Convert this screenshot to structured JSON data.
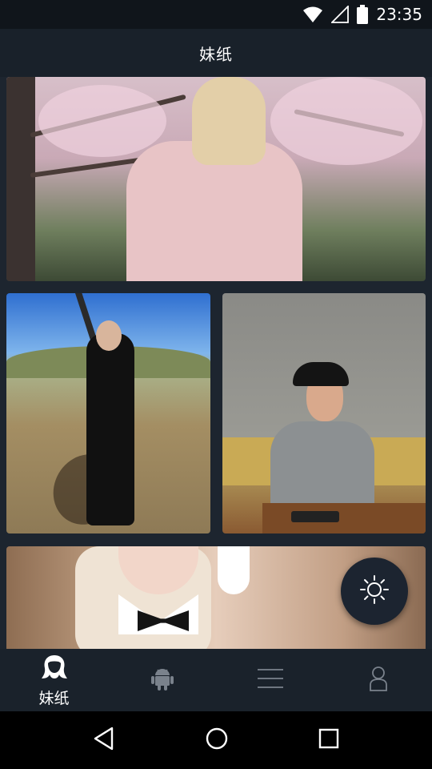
{
  "status_bar": {
    "time": "23:35",
    "icons": [
      "wifi-icon",
      "cellular-signal-icon",
      "battery-icon"
    ]
  },
  "title_bar": {
    "title": "妹纸"
  },
  "feed": {
    "images": [
      {
        "name": "photo-cherry-blossom"
      },
      {
        "name": "photo-desert-rifle"
      },
      {
        "name": "photo-cafe-cap"
      },
      {
        "name": "photo-bunny-costume"
      }
    ]
  },
  "fab": {
    "icon": "brightness-icon"
  },
  "bottom_nav": {
    "items": [
      {
        "icon": "girl-avatar-icon",
        "label": "妹纸",
        "active": true
      },
      {
        "icon": "android-icon",
        "label": ""
      },
      {
        "icon": "menu-icon",
        "label": ""
      },
      {
        "icon": "profile-icon",
        "label": ""
      }
    ]
  },
  "system_nav": {
    "buttons": [
      "back-icon",
      "home-icon",
      "recents-icon"
    ]
  },
  "colors": {
    "background": "#1b222b",
    "bar": "#19212a",
    "status_bar": "#10151b",
    "fab": "#1c2430",
    "icon": "#ffffff",
    "icon_inactive": "#7a828c"
  }
}
